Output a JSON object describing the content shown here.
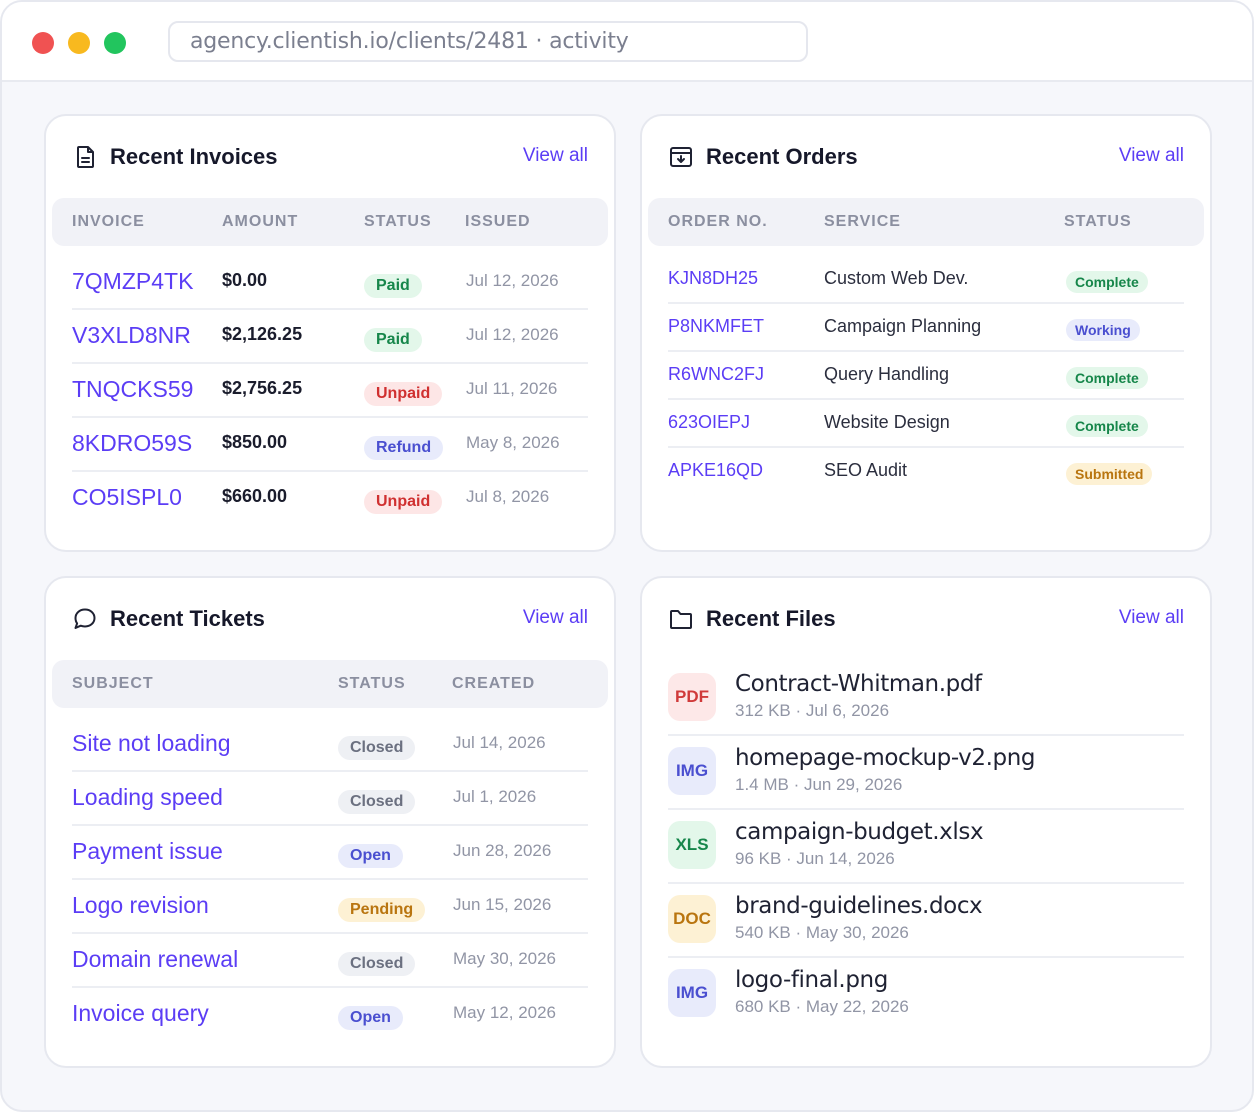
{
  "browser": {
    "url": "agency.clientish.io/clients/2481 · activity"
  },
  "invoices": {
    "title": "Recent Invoices",
    "view_all": "View all",
    "headers": [
      "INVOICE",
      "AMOUNT",
      "STATUS",
      "ISSUED"
    ],
    "rows": [
      {
        "id": "7QMZP4TK",
        "amount": "$0.00",
        "status": "Paid",
        "issued": "Jul 12, 2026"
      },
      {
        "id": "V3XLD8NR",
        "amount": "$2,126.25",
        "status": "Paid",
        "issued": "Jul 12, 2026"
      },
      {
        "id": "TNQCKS59",
        "amount": "$2,756.25",
        "status": "Unpaid",
        "issued": "Jul 11, 2026"
      },
      {
        "id": "8KDRO59S",
        "amount": "$850.00",
        "status": "Refund",
        "issued": "May 8, 2026"
      },
      {
        "id": "CO5ISPL0",
        "amount": "$660.00",
        "status": "Unpaid",
        "issued": "Jul 8, 2026"
      }
    ]
  },
  "orders": {
    "title": "Recent Orders",
    "view_all": "View all",
    "headers": [
      "ORDER NO.",
      "SERVICE",
      "STATUS"
    ],
    "rows": [
      {
        "id": "KJN8DH25",
        "service": "Custom Web Dev.",
        "status": "Complete"
      },
      {
        "id": "P8NKMFET",
        "service": "Campaign Planning",
        "status": "Working"
      },
      {
        "id": "R6WNC2FJ",
        "service": "Query Handling",
        "status": "Complete"
      },
      {
        "id": "623OIEPJ",
        "service": "Website Design",
        "status": "Complete"
      },
      {
        "id": "APKE16QD",
        "service": "SEO Audit",
        "status": "Submitted"
      }
    ]
  },
  "tickets": {
    "title": "Recent Tickets",
    "view_all": "View all",
    "headers": [
      "SUBJECT",
      "STATUS",
      "CREATED"
    ],
    "rows": [
      {
        "subject": "Site not loading",
        "status": "Closed",
        "created": "Jul 14, 2026"
      },
      {
        "subject": "Loading speed",
        "status": "Closed",
        "created": "Jul 1, 2026"
      },
      {
        "subject": "Payment issue",
        "status": "Open",
        "created": "Jun 28, 2026"
      },
      {
        "subject": "Logo revision",
        "status": "Pending",
        "created": "Jun 15, 2026"
      },
      {
        "subject": "Domain renewal",
        "status": "Closed",
        "created": "May 30, 2026"
      },
      {
        "subject": "Invoice query",
        "status": "Open",
        "created": "May 12, 2026"
      }
    ]
  },
  "files": {
    "title": "Recent Files",
    "view_all": "View all",
    "rows": [
      {
        "type": "PDF",
        "name": "Contract-Whitman.pdf",
        "meta": "312 KB · Jul 6, 2026"
      },
      {
        "type": "IMG",
        "name": "homepage-mockup-v2.png",
        "meta": "1.4 MB · Jun 29, 2026"
      },
      {
        "type": "XLS",
        "name": "campaign-budget.xlsx",
        "meta": "96 KB · Jun 14, 2026"
      },
      {
        "type": "DOC",
        "name": "brand-guidelines.docx",
        "meta": "540 KB · May 30, 2026"
      },
      {
        "type": "IMG",
        "name": "logo-final.png",
        "meta": "680 KB · May 22, 2026"
      }
    ]
  },
  "icons": {
    "invoices": "document-icon",
    "orders": "order-box-icon",
    "tickets": "chat-bubble-icon",
    "files": "folder-icon"
  },
  "colors": {
    "accent": "#5b3df5",
    "green": "#16864a",
    "red": "#d03030",
    "blue": "#4a4fd0",
    "amber": "#b9750f",
    "gray": "#6b7080"
  }
}
